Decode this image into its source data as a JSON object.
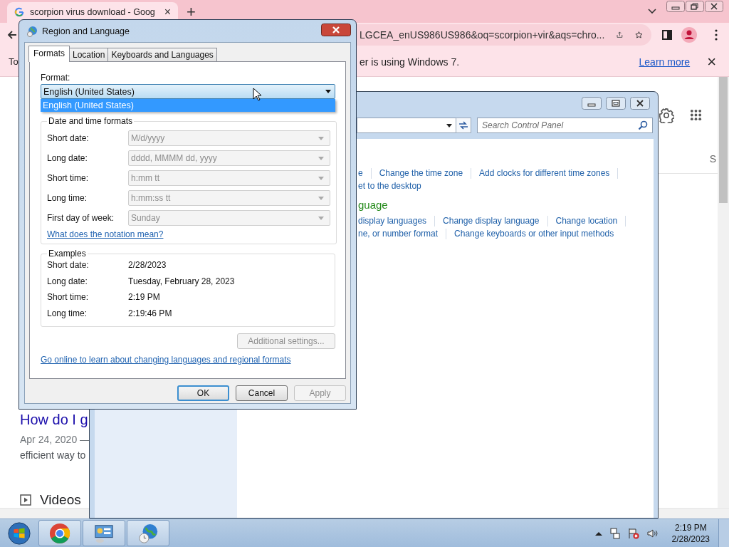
{
  "browser": {
    "tab": {
      "title": "scorpion virus download - Goog",
      "close": "×"
    },
    "new_tab": "+",
    "address": "LGCEA_enUS986US986&oq=scorpion+vir&aqs=chro...",
    "infobar": {
      "text_start": "To",
      "text_end": "er is using Windows 7.",
      "link": "Learn more",
      "close": "×"
    },
    "page": {
      "result": {
        "title": "How do I g",
        "date": "Apr 24, 2020 —",
        "snippet": "efficient way to"
      },
      "section": "Videos",
      "side_letter": "S"
    }
  },
  "control_panel": {
    "search": {
      "placeholder": "Search Control Panel"
    },
    "rows": [
      {
        "kind": "links",
        "links": [
          "e",
          "Change the time zone",
          "Add clocks for different time zones"
        ],
        "trailing_divider": true
      },
      {
        "kind": "links",
        "links": [
          "et to the desktop"
        ],
        "trailing_divider": false
      },
      {
        "kind": "heading",
        "text": "guage"
      },
      {
        "kind": "links",
        "links": [
          "display languages",
          "Change display language",
          "Change location"
        ],
        "trailing_divider": true
      },
      {
        "kind": "links",
        "links": [
          "ne, or number format",
          "Change keyboards or other input methods"
        ],
        "trailing_divider": false
      }
    ]
  },
  "dialog": {
    "title": "Region and Language",
    "tabs": [
      {
        "label": "Formats",
        "selected": true
      },
      {
        "label": "Location",
        "selected": false
      },
      {
        "label": "Keyboards and Languages",
        "selected": false
      }
    ],
    "format": {
      "label": "Format:",
      "value": "English (United States)",
      "options": [
        {
          "label": "English (United States)",
          "selected": true
        }
      ]
    },
    "formats_group": {
      "title": "Date and time formats",
      "rows": [
        {
          "label": "Short date:",
          "value": "M/d/yyyy",
          "disabled": true
        },
        {
          "label": "Long date:",
          "value": "dddd, MMMM dd, yyyy",
          "disabled": true
        },
        {
          "label": "Short time:",
          "value": "h:mm tt",
          "disabled": true
        },
        {
          "label": "Long time:",
          "value": "h:mm:ss tt",
          "disabled": true
        },
        {
          "label": "First day of week:",
          "value": "Sunday",
          "disabled": true
        }
      ],
      "link": "What does the notation mean?"
    },
    "examples": {
      "title": "Examples",
      "rows": [
        {
          "label": "Short date:",
          "value": "2/28/2023"
        },
        {
          "label": "Long date:",
          "value": "Tuesday, February 28, 2023"
        },
        {
          "label": "Short time:",
          "value": "2:19 PM"
        },
        {
          "label": "Long time:",
          "value": "2:19:46 PM"
        }
      ]
    },
    "additional_button": {
      "label": "Additional settings...",
      "disabled": true
    },
    "online_link": "Go online to learn about changing languages and regional formats",
    "buttons": [
      {
        "label": "OK",
        "default": true,
        "disabled": false
      },
      {
        "label": "Cancel",
        "default": false,
        "disabled": false
      },
      {
        "label": "Apply",
        "default": false,
        "disabled": true
      }
    ]
  },
  "taskbar": {
    "apps": [
      {
        "kind": "browser"
      },
      {
        "kind": "control-panel"
      },
      {
        "kind": "region"
      }
    ],
    "clock": {
      "time": "2:19 PM",
      "date": "2/28/2023"
    }
  }
}
